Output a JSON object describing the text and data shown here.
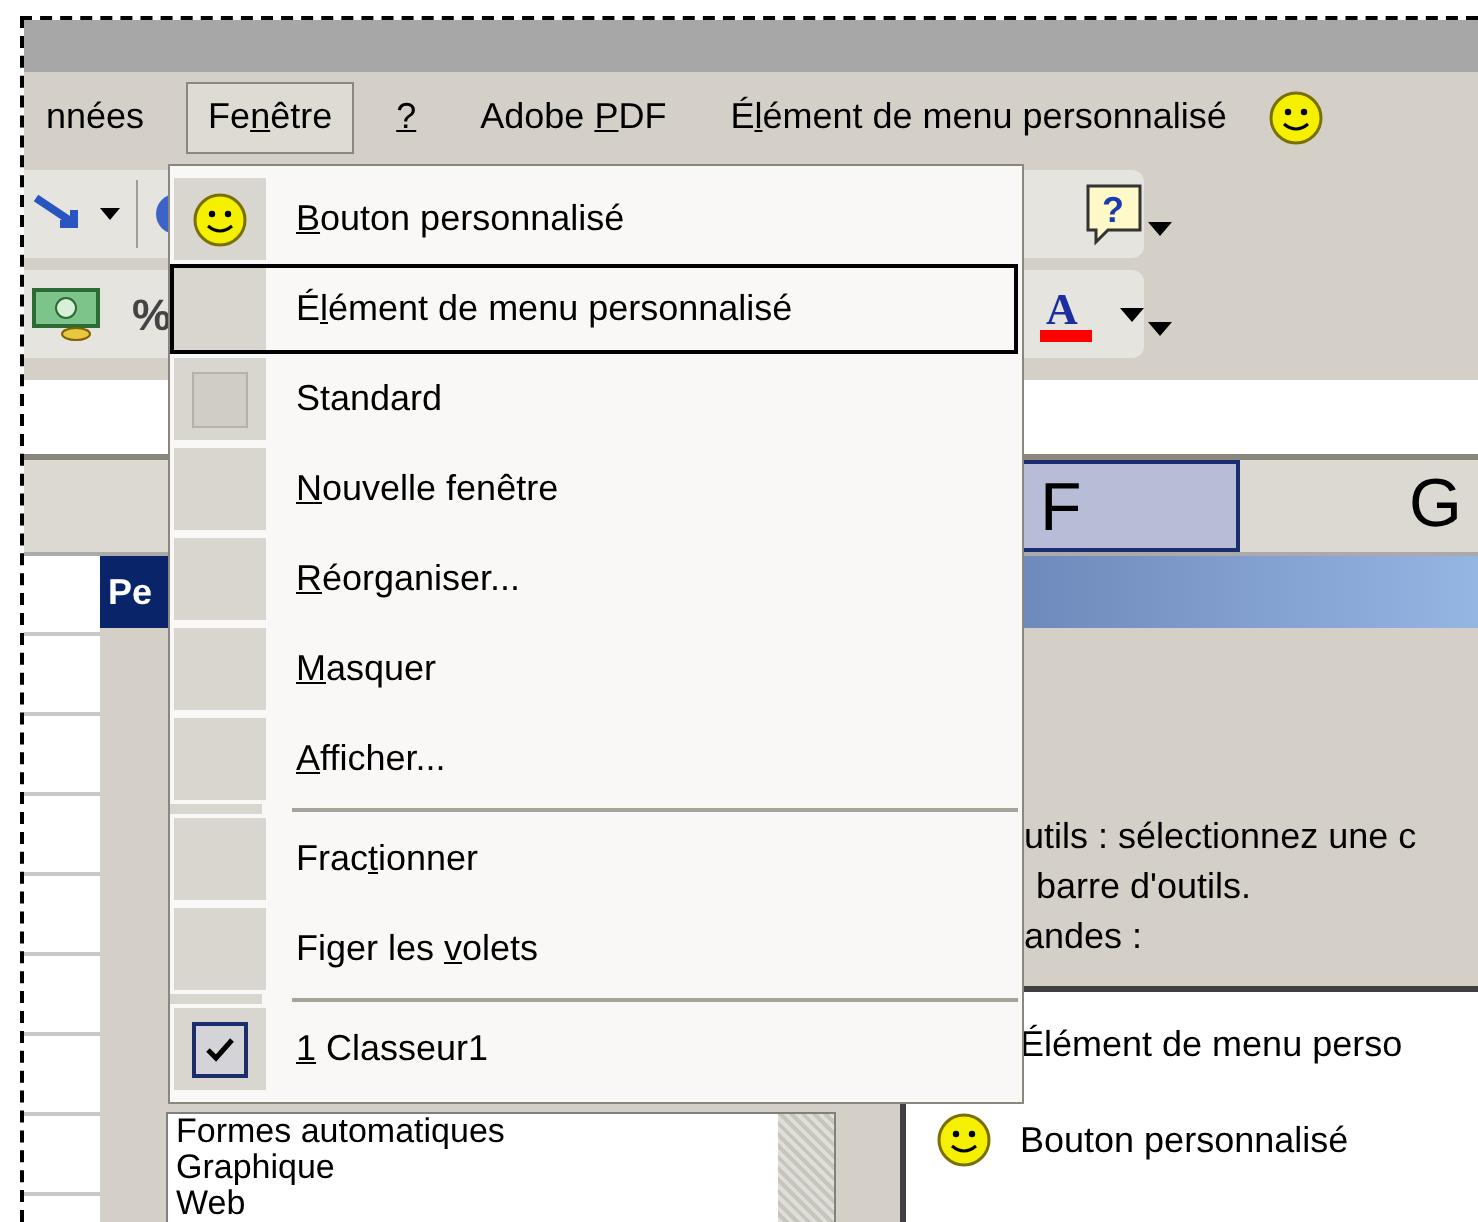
{
  "menu_bar": {
    "items": [
      {
        "label": {
          "before": "nnées"
        },
        "selected": false
      },
      {
        "label": {
          "before": "Fe",
          "key": "n",
          "after": "être"
        },
        "selected": true
      },
      {
        "label": {
          "key": "?"
        },
        "selected": false
      },
      {
        "label": {
          "before": "Adobe ",
          "key": "P",
          "after": "DF"
        },
        "selected": false
      },
      {
        "label": {
          "before": "É",
          "key": "l",
          "after": "ément de menu personnalisé"
        },
        "selected": false
      }
    ]
  },
  "toolbar": {
    "percent_label": "%",
    "help_glyph": "?",
    "font_color_glyph": "A"
  },
  "column_headers": [
    {
      "label": "F",
      "selected": true
    },
    {
      "label": "G",
      "selected": false
    }
  ],
  "dialog": {
    "title": "Pe",
    "instructions": [
      "utils : sélectionnez une c",
      "barre d'outils."
    ],
    "commands_label": "andes :",
    "categories": [
      "Formes automatiques",
      "Graphique",
      "Web"
    ],
    "commands": [
      {
        "label": "Élément de menu perso",
        "kind": "plain"
      },
      {
        "label": "Bouton personnalisé",
        "kind": "smiley"
      }
    ]
  },
  "dropdown_menu": {
    "items": [
      {
        "kind": "smiley",
        "label": {
          "key": "B",
          "after": "outon personnalisé"
        },
        "selected": false
      },
      {
        "kind": "plain",
        "label": {
          "before": "É",
          "key": "l",
          "after": "ément de menu personnalisé"
        },
        "selected": true
      },
      {
        "kind": "toggle",
        "label": {
          "before": "Standard"
        },
        "checked": false,
        "selected": false
      },
      {
        "kind": "plain",
        "label": {
          "key": "N",
          "after": "ouvelle fenêtre"
        },
        "selected": false
      },
      {
        "kind": "plain",
        "label": {
          "key": "R",
          "after": "éorganiser..."
        },
        "selected": false
      },
      {
        "kind": "plain",
        "label": {
          "key": "M",
          "after": "asquer"
        },
        "selected": false
      },
      {
        "kind": "plain",
        "label": {
          "key": "A",
          "after": "fficher..."
        },
        "selected": false
      },
      {
        "kind": "separator"
      },
      {
        "kind": "plain",
        "label": {
          "before": "Frac",
          "key": "t",
          "after": "ionner"
        },
        "selected": false
      },
      {
        "kind": "plain",
        "label": {
          "before": "Figer les ",
          "key": "v",
          "after": "olets"
        },
        "selected": false
      },
      {
        "kind": "separator"
      },
      {
        "kind": "toggle",
        "label": {
          "key": "1",
          "after": " Classeur1"
        },
        "checked": true,
        "selected": false
      }
    ]
  }
}
